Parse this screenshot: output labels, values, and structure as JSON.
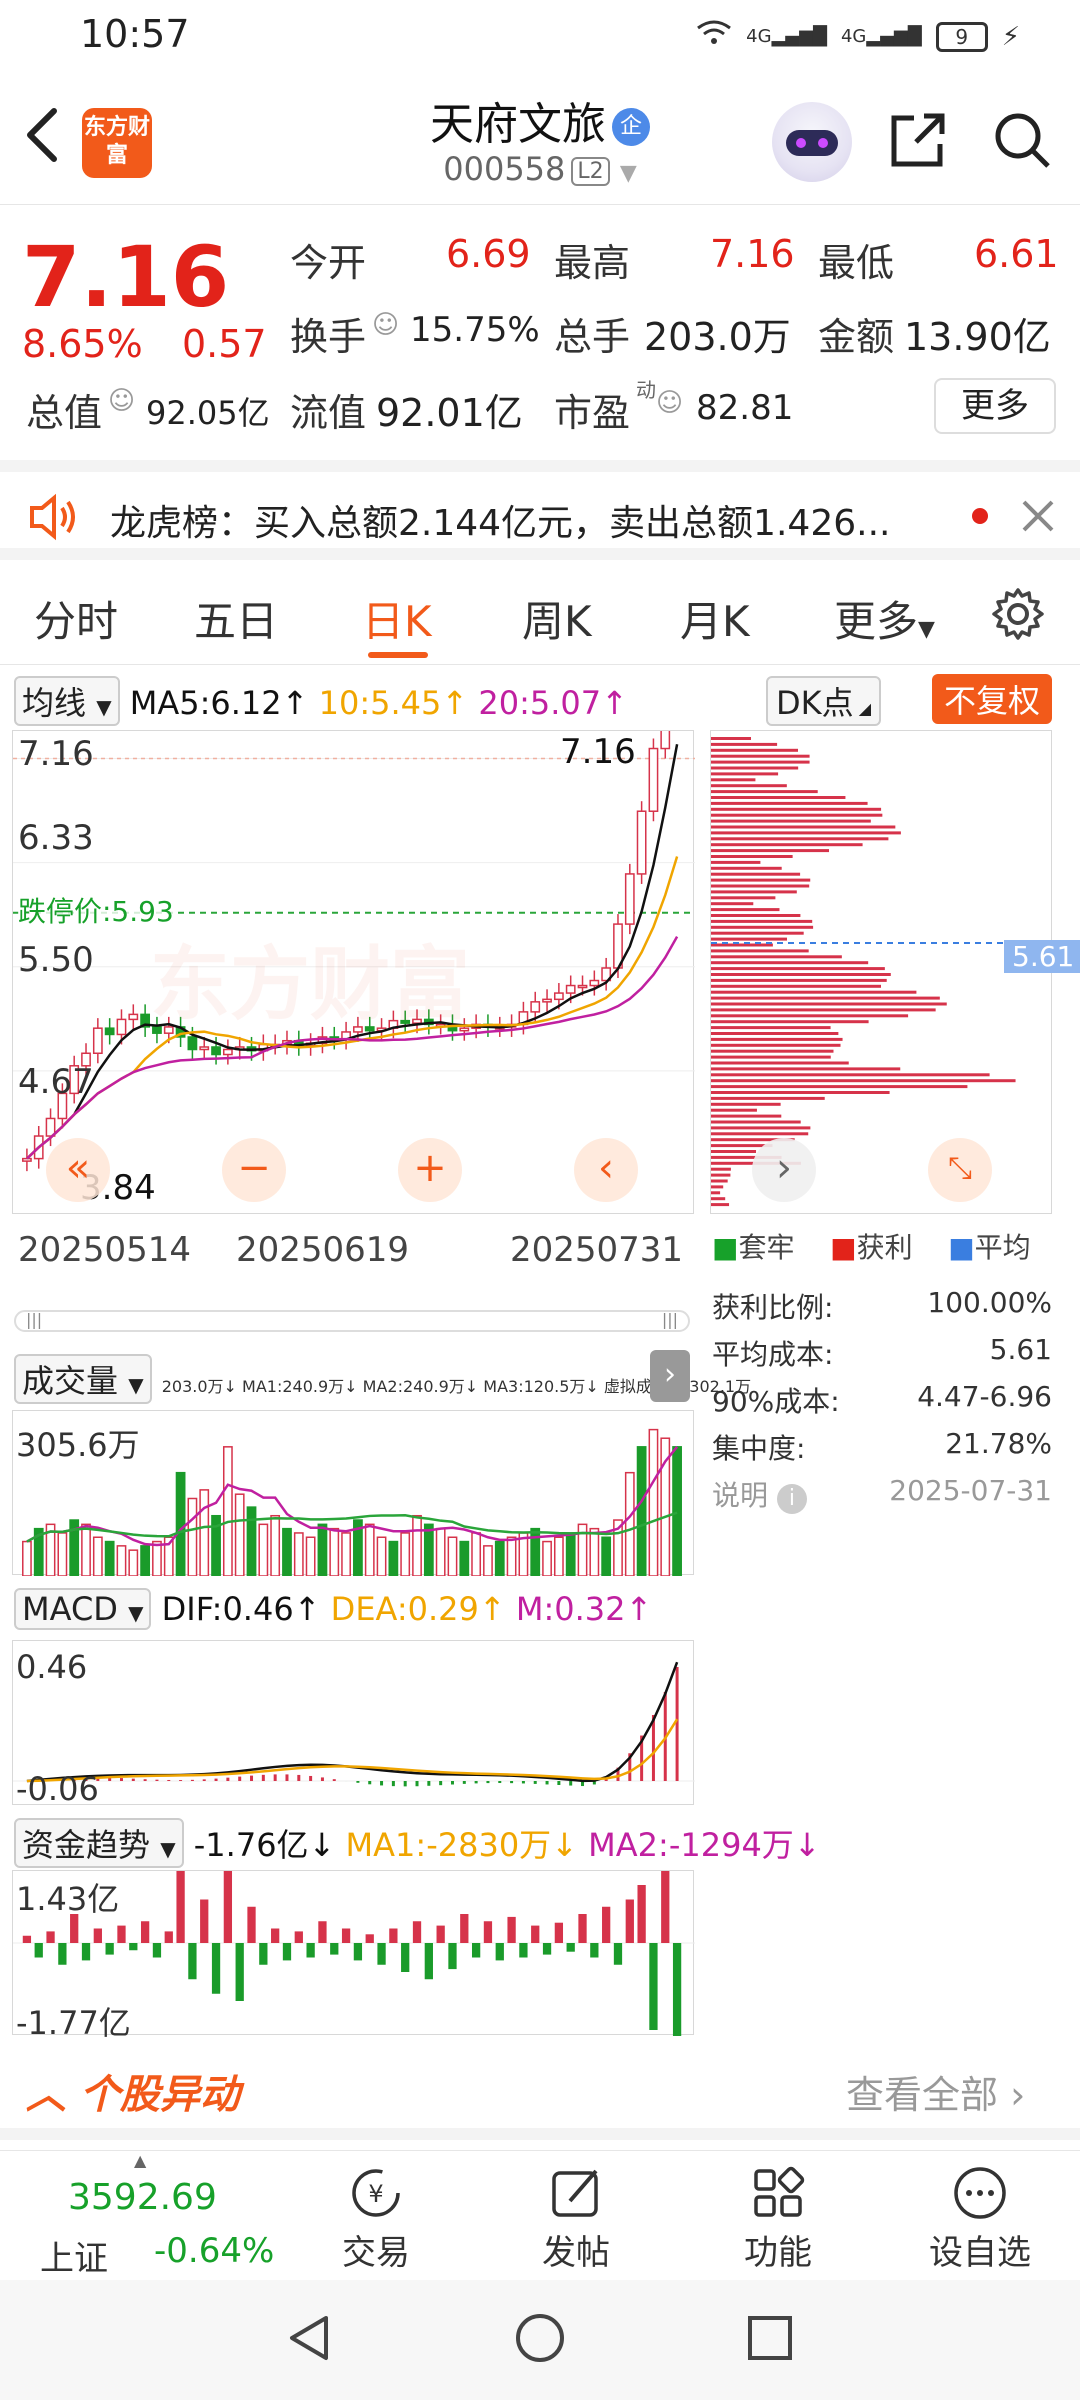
{
  "status": {
    "time": "10:57",
    "signal1": "4G",
    "signal2": "4G",
    "battery": "9"
  },
  "header": {
    "logo_text": "东方财富",
    "stock_name": "天府文旅",
    "qi_badge": "企",
    "code": "000558",
    "level": "L2"
  },
  "quote": {
    "price": "7.16",
    "pct": "8.65%",
    "change": "0.57",
    "open_label": "今开",
    "open": "6.69",
    "high_label": "最高",
    "high": "7.16",
    "low_label": "最低",
    "low": "6.61",
    "turnover_label": "换手",
    "turnover": "15.75%",
    "volume_label": "总手",
    "volume": "203.0万",
    "amount_label": "金额",
    "amount": "13.90亿",
    "mcap_label": "总值",
    "mcap": "92.05亿",
    "float_label": "流值",
    "float": "92.01亿",
    "pe_label": "市盈",
    "pe_sup": "动",
    "pe": "82.81",
    "more": "更多"
  },
  "notice": {
    "text": "龙虎榜：买入总额2.144亿元，卖出总额1.426..."
  },
  "tabs": [
    "分时",
    "五日",
    "日K",
    "周K",
    "月K",
    "更多"
  ],
  "kline": {
    "ma_selector": "均线",
    "ma5": "MA5:6.12↑",
    "ma10": "10:5.45↑",
    "ma20": "20:5.07↑",
    "dk_label": "DK点",
    "fq_label": "不复权",
    "y_labels": [
      "7.16",
      "6.33",
      "5.50",
      "4.67",
      "3.84"
    ],
    "limit_down": "跌停价:5.93",
    "last_price_tag": "7.16",
    "low_tag": "3.84",
    "dates": [
      "20250514",
      "20250619",
      "20250731"
    ],
    "watermark": "东方财富",
    "chip_avg": "5.61"
  },
  "chip": {
    "legend": [
      "套牢",
      "获利",
      "平均"
    ],
    "rows": [
      {
        "k": "获利比例:",
        "v": "100.00%"
      },
      {
        "k": "平均成本:",
        "v": "5.61"
      },
      {
        "k": "90%成本:",
        "v": "4.47-6.96"
      },
      {
        "k": "集中度:",
        "v": "21.78%"
      }
    ],
    "note_label": "说明",
    "date": "2025-07-31"
  },
  "volume": {
    "label": "成交量",
    "legend": "203.0万↓ MA1:240.9万↓ MA2:240.9万↓ MA3:120.5万↓ 虚拟成交量:302.1万",
    "max_label": "305.6万"
  },
  "macd": {
    "label": "MACD",
    "dif": "DIF:0.46↑",
    "dea": "DEA:0.29↑",
    "m": "M:0.32↑",
    "top": "0.46",
    "bottom": "-0.06"
  },
  "fund": {
    "label": "资金趋势",
    "v": "-1.76亿↓",
    "ma1": "MA1:-2830万↓",
    "ma2": "MA2:-1294万↓",
    "top": "1.43亿",
    "bottom": "-1.77亿"
  },
  "abnormal": {
    "title": "个股异动",
    "view_all": "查看全部"
  },
  "bottom_nav": {
    "index_value": "3592.69",
    "index_name": "上证",
    "index_pct": "-0.64%",
    "items": [
      "交易",
      "发帖",
      "功能",
      "设自选"
    ]
  },
  "colors": {
    "accent": "#f25a1a",
    "up": "#e2231a",
    "down": "#17a12a"
  }
}
